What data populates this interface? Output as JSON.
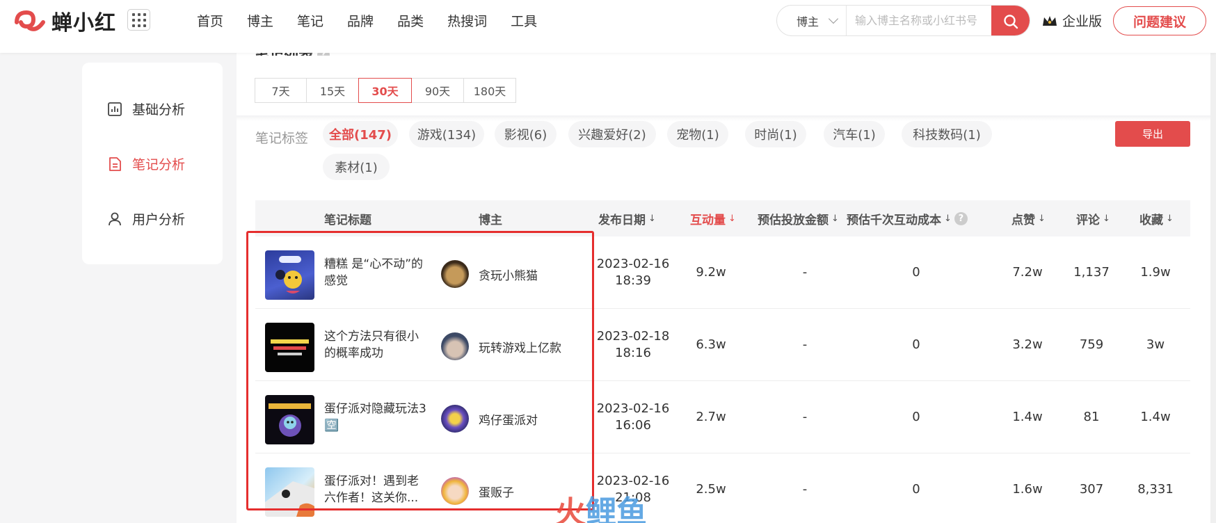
{
  "header": {
    "logo_text": "蝉小红",
    "nav": [
      "首页",
      "博主",
      "笔记",
      "品牌",
      "品类",
      "热搜词",
      "工具"
    ],
    "search_type": "博主",
    "search_placeholder": "输入博主名称或小红书号",
    "enterprise_label": "企业版",
    "feedback_label": "问题建议"
  },
  "sidebar": {
    "items": [
      {
        "label": "基础分析",
        "icon": "bar-chart-icon",
        "active": false
      },
      {
        "label": "笔记分析",
        "icon": "document-icon",
        "active": true
      },
      {
        "label": "用户分析",
        "icon": "user-icon",
        "active": false
      }
    ]
  },
  "main": {
    "section_title": "笔记列表",
    "help_mark": "?",
    "ranges": [
      "7天",
      "15天",
      "30天",
      "90天",
      "180天"
    ],
    "active_range": "30天",
    "tag_label": "笔记标签",
    "tags": [
      "全部(147)",
      "游戏(134)",
      "影视(6)",
      "兴趣爱好(2)",
      "宠物(1)",
      "时尚(1)",
      "汽车(1)",
      "科技数码(1)",
      "素材(1)"
    ],
    "active_tag": "全部(147)",
    "export_label": "导出"
  },
  "table": {
    "headers": {
      "title": "笔记标题",
      "blogger": "博主",
      "date": "发布日期",
      "interaction": "互动量",
      "est_amount": "预估投放金额",
      "est_cpm": "预估千次互动成本",
      "likes": "点赞",
      "comments": "评论",
      "favorites": "收藏"
    },
    "sort_arrow": "↓",
    "rows": [
      {
        "title": "糟糕 是“心不动”的感觉",
        "blogger": "贪玩小熊猫",
        "date": "2023-02-16",
        "time": "18:39",
        "interaction": "9.2w",
        "est_amount": "-",
        "est_cpm": "0",
        "likes": "7.2w",
        "comments": "1,137",
        "favorites": "1.9w"
      },
      {
        "title": "这个方法只有很小的概率成功",
        "blogger": "玩转游戏上亿款",
        "date": "2023-02-18",
        "time": "18:16",
        "interaction": "6.3w",
        "est_amount": "-",
        "est_cpm": "0",
        "likes": "3.2w",
        "comments": "759",
        "favorites": "3w"
      },
      {
        "title": "蛋仔派对隐藏玩法3🈳",
        "blogger": "鸡仔蛋派对",
        "date": "2023-02-16",
        "time": "16:06",
        "interaction": "2.7w",
        "est_amount": "-",
        "est_cpm": "0",
        "likes": "1.4w",
        "comments": "81",
        "favorites": "1.4w"
      },
      {
        "title": "蛋仔派对！遇到老六作者！这关你...",
        "blogger": "蛋贩子",
        "date": "2023-02-16",
        "time": "21:08",
        "interaction": "2.5w",
        "est_amount": "-",
        "est_cpm": "0",
        "likes": "1.6w",
        "comments": "307",
        "favorites": "8,331"
      }
    ]
  },
  "watermark": {
    "part_a": "火",
    "part_b": "鲤鱼"
  },
  "colors": {
    "accent": "#e34c4c",
    "highlight_box": "#e52e2e"
  }
}
